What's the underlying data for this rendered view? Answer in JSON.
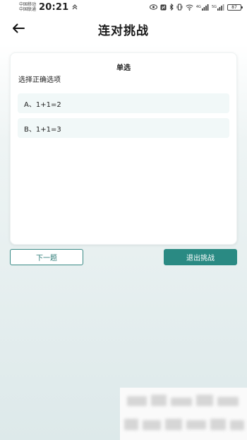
{
  "status_bar": {
    "carrier_1": "中国移动",
    "carrier_2": "中国联通",
    "time": "20:21",
    "network_label_1": "4G",
    "network_label_2": "5G",
    "battery": "87"
  },
  "header": {
    "back_icon": "back-arrow-icon",
    "title": "连对挑战"
  },
  "question": {
    "type": "单选",
    "prompt": "选择正确选项",
    "options": [
      {
        "label": "A、1+1=2"
      },
      {
        "label": "B、1+1=3"
      }
    ]
  },
  "actions": {
    "next_label": "下一题",
    "exit_label": "退出挑战"
  },
  "colors": {
    "accent": "#2a8a83",
    "option_bg": "#f1f8f8",
    "page_bg_bottom": "#dde9ea"
  }
}
